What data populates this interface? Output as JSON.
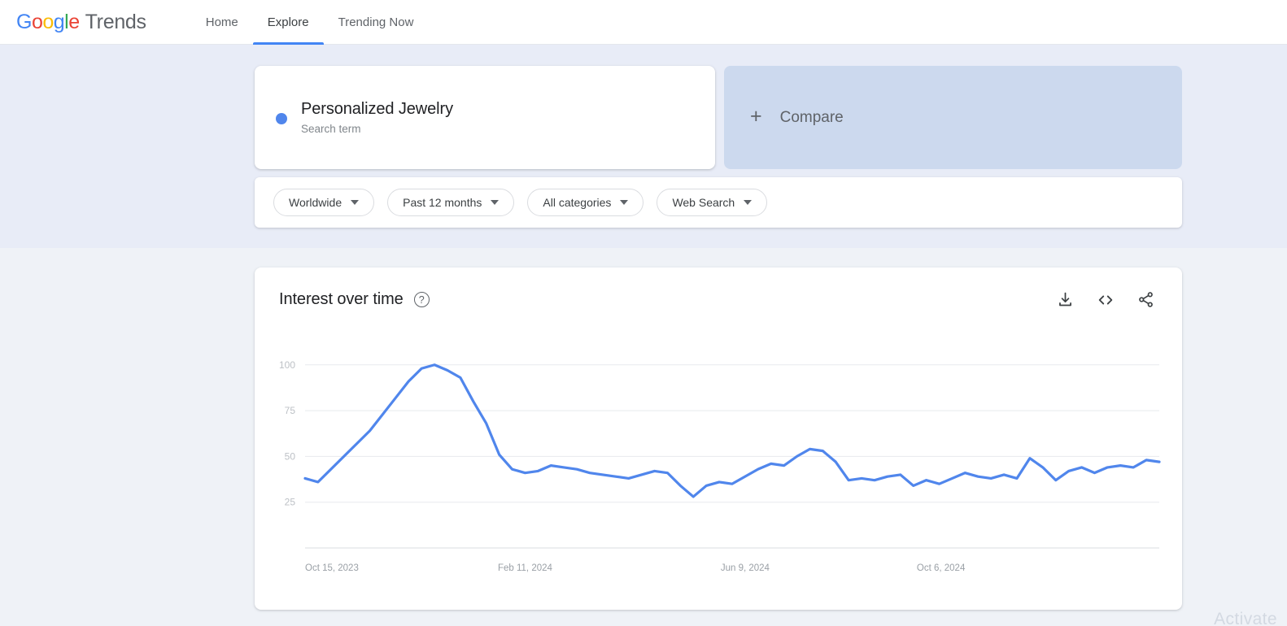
{
  "header": {
    "logo": {
      "g1": "G",
      "o1": "o",
      "o2": "o",
      "g2": "g",
      "l": "l",
      "e": "e",
      "product": "Trends"
    },
    "nav": [
      {
        "label": "Home",
        "active": false
      },
      {
        "label": "Explore",
        "active": true
      },
      {
        "label": "Trending Now",
        "active": false
      }
    ]
  },
  "query": {
    "term": {
      "title": "Personalized Jewelry",
      "subtitle": "Search term",
      "color": "#5086ec"
    },
    "compare": {
      "label": "Compare",
      "plus": "+"
    }
  },
  "filters": [
    {
      "label": "Worldwide",
      "name": "location-filter"
    },
    {
      "label": "Past 12 months",
      "name": "time-range-filter"
    },
    {
      "label": "All categories",
      "name": "category-filter"
    },
    {
      "label": "Web Search",
      "name": "search-type-filter"
    }
  ],
  "chart_card": {
    "title": "Interest over time",
    "help": "?",
    "actions": [
      {
        "name": "download-icon",
        "label": "Download"
      },
      {
        "name": "embed-code-icon",
        "label": "Embed"
      },
      {
        "name": "share-icon",
        "label": "Share"
      }
    ]
  },
  "watermark": "Activate",
  "chart_data": {
    "type": "line",
    "title": "Interest over time",
    "xlabel": "",
    "ylabel": "",
    "ylim": [
      0,
      107
    ],
    "yticks": [
      100,
      75,
      50,
      25
    ],
    "grid": true,
    "legend": false,
    "line_color": "#5086ec",
    "xticks": [
      "Oct 15, 2023",
      "Feb 11, 2024",
      "Jun 9, 2024",
      "Oct 6, 2024"
    ],
    "xtick_index": [
      0,
      17,
      34,
      51
    ],
    "series": [
      {
        "name": "Personalized Jewelry",
        "values": [
          38,
          36,
          43,
          50,
          57,
          64,
          73,
          82,
          91,
          98,
          100,
          97,
          93,
          80,
          68,
          51,
          43,
          41,
          42,
          45,
          44,
          43,
          41,
          40,
          39,
          38,
          40,
          42,
          41,
          34,
          28,
          34,
          36,
          35,
          39,
          43,
          46,
          45,
          50,
          54,
          53,
          47,
          37,
          38,
          37,
          39,
          40,
          34,
          37,
          35,
          38,
          41,
          39,
          38,
          40,
          38,
          49,
          44,
          37,
          42,
          44,
          41,
          44,
          45,
          44,
          48,
          47
        ]
      }
    ],
    "x": [
      "Oct 15, 2023",
      "Oct 22, 2023",
      "Oct 29, 2023",
      "Nov 5, 2023",
      "Nov 12, 2023",
      "Nov 19, 2023",
      "Nov 26, 2023",
      "Dec 3, 2023",
      "Dec 10, 2023",
      "Dec 17, 2023",
      "Dec 24, 2023",
      "Dec 31, 2023",
      "Jan 7, 2024",
      "Jan 14, 2024",
      "Jan 21, 2024",
      "Jan 28, 2024",
      "Feb 4, 2024",
      "Feb 11, 2024",
      "Feb 18, 2024",
      "Feb 25, 2024",
      "Mar 3, 2024",
      "Mar 10, 2024",
      "Mar 17, 2024",
      "Mar 24, 2024",
      "Mar 31, 2024",
      "Apr 7, 2024",
      "Apr 14, 2024",
      "Apr 21, 2024",
      "Apr 28, 2024",
      "May 5, 2024",
      "May 12, 2024",
      "May 19, 2024",
      "May 26, 2024",
      "Jun 2, 2024",
      "Jun 9, 2024",
      "Jun 16, 2024",
      "Jun 23, 2024",
      "Jun 30, 2024",
      "Jul 7, 2024",
      "Jul 14, 2024",
      "Jul 21, 2024",
      "Jul 28, 2024",
      "Aug 4, 2024",
      "Aug 11, 2024",
      "Aug 18, 2024",
      "Aug 25, 2024",
      "Sep 1, 2024",
      "Sep 8, 2024",
      "Sep 15, 2024",
      "Sep 22, 2024",
      "Sep 29, 2024",
      "Oct 6, 2024",
      "Oct 13, 2024",
      "Oct 20, 2024",
      "Oct 27, 2024",
      "Nov 3, 2024",
      "Nov 10, 2024",
      "Nov 17, 2024",
      "Nov 24, 2024",
      "Dec 1, 2024",
      "Dec 8, 2024",
      "Dec 15, 2024",
      "Dec 22, 2024",
      "Dec 29, 2024",
      "Jan 5, 2025",
      "Jan 12, 2025",
      "Jan 19, 2025"
    ]
  }
}
